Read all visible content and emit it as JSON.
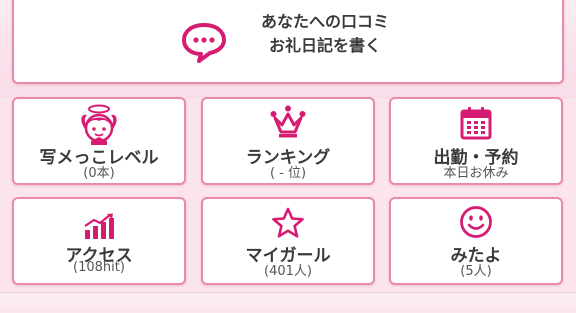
{
  "colors": {
    "accent": "#d81b72",
    "border": "#e98aaa",
    "background": "#fbe4ee"
  },
  "review_button": {
    "icon": "chat-bubble-icon",
    "line1": "あなたへの口コミ",
    "line2": "お礼日記を書く"
  },
  "tiles": [
    {
      "icon": "angel-icon",
      "label": "写メっこレベル",
      "sub": "(0本)"
    },
    {
      "icon": "crown-icon",
      "label": "ランキング",
      "sub": "( - 位)"
    },
    {
      "icon": "calendar-icon",
      "label": "出勤・予約",
      "sub": "本日お休み"
    },
    {
      "icon": "chart-icon",
      "label": "アクセス",
      "sub": "(108hit)"
    },
    {
      "icon": "star-icon",
      "label": "マイガール",
      "sub": "(401人)"
    },
    {
      "icon": "smile-icon",
      "label": "みたよ",
      "sub": "(5人)"
    }
  ]
}
